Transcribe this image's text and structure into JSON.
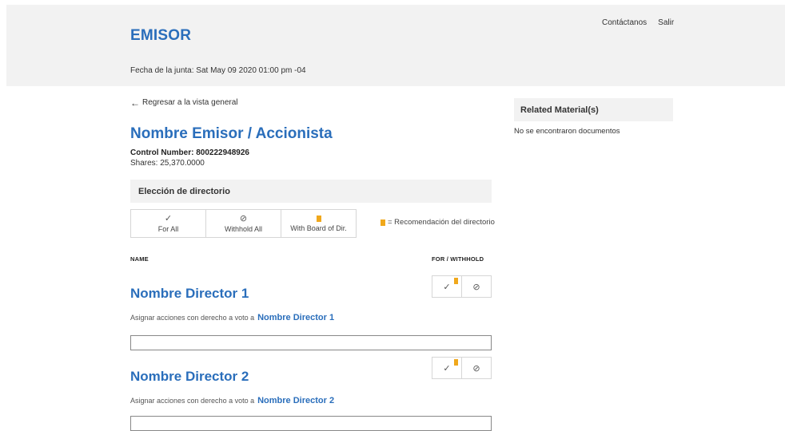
{
  "header": {
    "brand": "EMISOR",
    "meeting_date": "Fecha de la junta: Sat May 09 2020 01:00 pm -04",
    "links": {
      "contact": "Contáctanos",
      "logout": "Salir"
    }
  },
  "main": {
    "back_link": "Regresar a la vista general",
    "holder_name": "Nombre Emisor / Accionista",
    "control_number": "Control Number: 800222948926",
    "shares": "Shares: 25,370.0000",
    "section_title": "Elección de directorio",
    "bulk_actions": {
      "for_all": "For All",
      "withhold_all": "Withhold All",
      "with_board": "With Board of Dir."
    },
    "legend_text": "= Recomendación del directorio",
    "columns": {
      "name": "NAME",
      "vote": "FOR / WITHHOLD"
    },
    "directors": [
      {
        "name": "Nombre Director 1",
        "assign_label": "Asignar acciones con derecho a voto a",
        "assign_name": "Nombre Director 1",
        "input_value": ""
      },
      {
        "name": "Nombre Director 2",
        "assign_label": "Asignar acciones con derecho a voto a",
        "assign_name": "Nombre Director 2",
        "input_value": ""
      }
    ]
  },
  "sidebar": {
    "title": "Related Material(s)",
    "empty_text": "No se encontraron documentos"
  },
  "icons": {
    "check": "check-icon",
    "withhold": "ban-icon",
    "flag": "bookmark-flag-icon",
    "back": "arrow-left-icon"
  },
  "colors": {
    "accent": "#2a6ebb",
    "flag": "#f0a81c",
    "panel": "#f2f2f2"
  }
}
